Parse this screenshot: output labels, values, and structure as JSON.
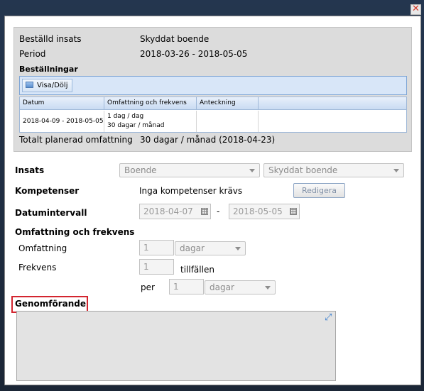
{
  "dialog": {
    "close_icon": "close-icon",
    "close_color": "#d23a2a"
  },
  "summary": {
    "ordered_label": "Beställd insats",
    "ordered_value": "Skyddat boende",
    "period_label": "Period",
    "period_value": "2018-03-26 - 2018-05-05",
    "orders_heading": "Beställningar",
    "toggle_button": "Visa/Dölj",
    "columns": [
      "Datum",
      "Omfattning och frekvens",
      "Anteckning"
    ],
    "rows": [
      {
        "datum": "2018-04-09 - 2018-05-05",
        "omfattning_line1": "1 dag / dag",
        "omfattning_line2": "30 dagar / månad",
        "anteckning": ""
      }
    ],
    "total_label": "Totalt planerad omfattning",
    "total_value": "30 dagar / månad (2018-04-23)"
  },
  "form": {
    "insats_label": "Insats",
    "insats_select1": "Boende",
    "insats_select2": "Skyddat boende",
    "kompetenser_label": "Kompetenser",
    "kompetenser_value": "Inga kompetenser krävs",
    "redigera_button": "Redigera",
    "datum_label": "Datumintervall",
    "date_from": "2018-04-07",
    "date_sep": "-",
    "date_to": "2018-05-05",
    "omf_heading": "Omfattning och frekvens",
    "omfattning_label": "Omfattning",
    "omfattning_value": "1",
    "omfattning_unit": "dagar",
    "frekvens_label": "Frekvens",
    "frekvens_value": "1",
    "frekvens_unit": "tillfällen",
    "per_label": "per",
    "per_value": "1",
    "per_unit": "dagar",
    "genomforande_label": "Genomförande",
    "highlight_color": "#d3252f"
  }
}
